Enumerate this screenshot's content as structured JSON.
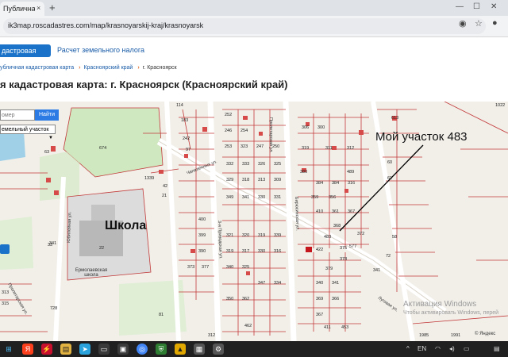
{
  "browser": {
    "tab_title": "Публичная кадастровая карт...",
    "tab_close": "×",
    "new_tab": "+",
    "url": "ik3map.roscadastres.com/map/krasnoyarskij-kraj/krasnoyarsk"
  },
  "site": {
    "nav_active": "дастровая карта",
    "nav_link": "Расчет земельного налога",
    "breadcrumb": [
      "убличная кадастровая карта",
      "Красноярский край",
      "г. Красноярск"
    ],
    "page_title": "я кадастровая карта: г. Красноярск (Красноярский край)"
  },
  "map": {
    "search_placeholder": "омер",
    "find_button": "Найти",
    "layer_select": "емельный участок",
    "school_label": "Школа",
    "annotation": "Мой участок 483",
    "highlight_parcel": "483",
    "streets": [
      "Кольцевая ул.",
      "ул. Чапаленных ул.",
      "Бирюсинская ул.",
      "Пролетарская ул.",
      "3-я Приводская ул.",
      "Луговая ул."
    ],
    "school_name": "Ермолаевская школа",
    "parcels": [
      "114",
      "183",
      "242",
      "97",
      "674",
      "63",
      "240",
      "53",
      "252",
      "254",
      "246",
      "253",
      "323",
      "247",
      "250",
      "309",
      "306",
      "300",
      "319",
      "311",
      "312",
      "310",
      "489",
      "60",
      "613",
      "611",
      "380",
      "388",
      "389",
      "384",
      "384",
      "316",
      "332",
      "333",
      "326",
      "325",
      "329",
      "318",
      "313",
      "309",
      "300",
      "349",
      "341",
      "330",
      "331",
      "320",
      "339",
      "318",
      "350",
      "358",
      "344",
      "342",
      "343",
      "360",
      "341",
      "410",
      "361",
      "359",
      "356",
      "367",
      "372",
      "483",
      "399",
      "400",
      "321",
      "319",
      "317",
      "330",
      "332",
      "340",
      "325",
      "373",
      "377",
      "390",
      "422",
      "375",
      "577",
      "378",
      "379",
      "347",
      "334",
      "350",
      "362",
      "340",
      "341",
      "369",
      "366",
      "367",
      "1339",
      "1022",
      "72",
      "58",
      "33",
      "22",
      "21",
      "42",
      "728",
      "81",
      "313",
      "315",
      "462",
      "312",
      "411",
      "453",
      "1985",
      "1991"
    ],
    "activation_title": "Активация Windows",
    "activation_sub": "Чтобы активировать Windows, перей",
    "attribution": "© Яндекс"
  },
  "taskbar": {
    "icons": [
      "windows-icon",
      "yandex-icon",
      "flash-icon",
      "telegram-icon",
      "terminal-icon",
      "media-icon",
      "chrome-icon",
      "shield-icon",
      "stats-icon",
      "explorer-icon",
      "settings-icon"
    ],
    "tray": [
      "^",
      "EN"
    ]
  }
}
